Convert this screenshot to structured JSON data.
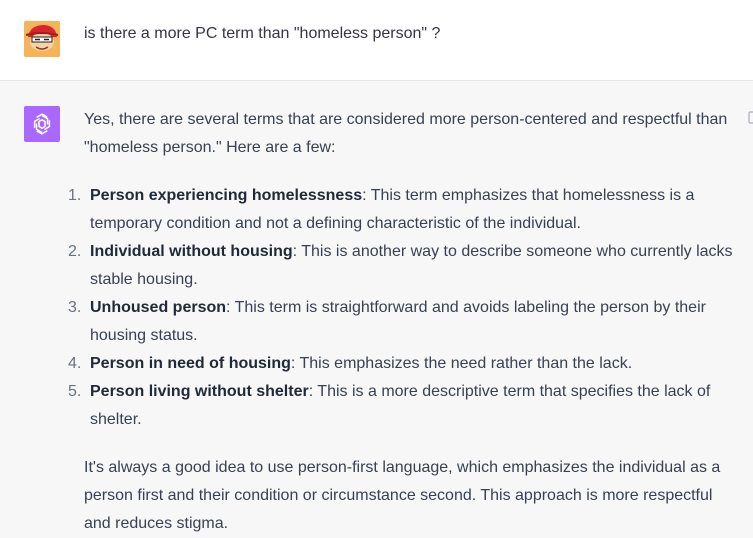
{
  "user_message": {
    "avatar_icon": "user-avatar-cartoon",
    "text": "is there a more PC term than \"homeless person\" ?"
  },
  "assistant_message": {
    "avatar_icon": "openai-logo-icon",
    "avatar_color": "#ab68ff",
    "intro": "Yes, there are several terms that are considered more person-centered and respectful than \"homeless person.\" Here are a few:",
    "items": [
      {
        "num": "1.",
        "term": "Person experiencing homelessness",
        "desc": ": This term emphasizes that homelessness is a temporary condition and not a defining characteristic of the individual."
      },
      {
        "num": "2.",
        "term": "Individual without housing",
        "desc": ": This is another way to describe someone who currently lacks stable housing."
      },
      {
        "num": "3.",
        "term": "Unhoused person",
        "desc": ": This term is straightforward and avoids labeling the person by their housing status."
      },
      {
        "num": "4.",
        "term": "Person in need of housing",
        "desc": ": This emphasizes the need rather than the lack."
      },
      {
        "num": "5.",
        "term": "Person living without shelter",
        "desc": ": This is a more descriptive term that specifies the lack of shelter."
      }
    ],
    "outro": "It's always a good idea to use person-first language, which emphasizes the individual as a person first and their condition or circumstance second. This approach is more respectful and reduces stigma."
  }
}
